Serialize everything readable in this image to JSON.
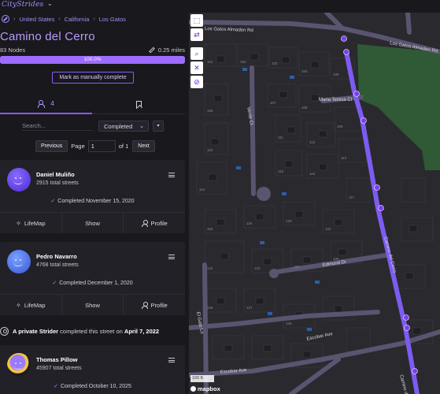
{
  "app": {
    "logo_text": "CityStrides",
    "logo_caret": "⌄"
  },
  "breadcrumb": {
    "items": [
      "United States",
      "California",
      "Los Gatos"
    ],
    "separator": "›"
  },
  "street": {
    "title": "Camino del Cerro",
    "nodes": "83 Nodes",
    "miles": "0.25 miles",
    "progress_label": "100.0%",
    "progress_fraction": 1.0,
    "mark_button": "Mark as manually complete"
  },
  "tabs": {
    "people_count": "4"
  },
  "filters": {
    "search_placeholder": "Search...",
    "status_value": "Completed",
    "status_chevron": "⌄",
    "more_label": "▾"
  },
  "pager": {
    "prev": "Previous",
    "page_label": "Page",
    "page_value": "1",
    "of_label": "of 1",
    "next": "Next"
  },
  "actions": {
    "lifemap": "LifeMap",
    "show": "Show",
    "profile": "Profile"
  },
  "users": [
    {
      "name": "Daniel Muliño",
      "streets": "2915 total streets",
      "completed": "Completed November 15, 2020"
    },
    {
      "name": "Pedro Navarro",
      "streets": "4768 total streets",
      "completed": "Completed December 1, 2020"
    },
    {
      "name": "Thomas Pillow",
      "streets": "45907 total streets",
      "completed": "Completed October 10, 2025"
    }
  ],
  "private_strider": {
    "prefix": "A private Strider",
    "middle": "completed this street on",
    "date": "April 7, 2022"
  },
  "map": {
    "streets": [
      "Los Gatos Almaden Rd",
      "Los Gatos Almaden Rd",
      "Maria Teresa Ct",
      "Camino del Cerro",
      "Camino del Cerro",
      "Edmund Dr",
      "Escobar Ave",
      "Escobar Ave",
      "El Gato Ln",
      "Verde Ct"
    ],
    "lot_numbers": [
      "101",
      "102",
      "103",
      "104",
      "105",
      "106",
      "107",
      "108",
      "109",
      "110",
      "111",
      "112",
      "113",
      "114",
      "115",
      "116",
      "117",
      "118",
      "119",
      "120",
      "121",
      "122",
      "123",
      "124",
      "125",
      "126",
      "127",
      "128"
    ],
    "scale_label": "100 ft",
    "attribution": "mapbox",
    "colors": {
      "road": "#5b5470",
      "route": "#7c5cf0",
      "node": "#7b3ff2",
      "park": "#2f5a35"
    }
  },
  "map_tools": [
    "⬚",
    "⇄",
    "⌕",
    "✕",
    "⊘"
  ]
}
